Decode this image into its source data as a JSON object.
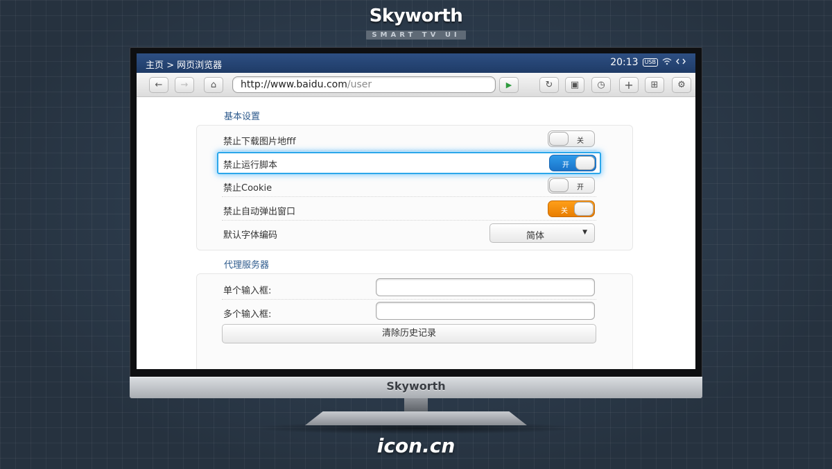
{
  "brand": {
    "name": "Skyworth",
    "subtitle": "SMART TV UI",
    "bezel_name": "Skyworth",
    "footer": "icon.cn"
  },
  "status_bar": {
    "breadcrumb": "主页 > 网页浏览器",
    "time": "20:13",
    "usb": "USB",
    "icons": [
      "wifi-icon",
      "network-transfer-icon"
    ]
  },
  "toolbar": {
    "url_host": "http://www.baidu.com",
    "url_path": "/user",
    "icons": {
      "back": "←",
      "forward": "→",
      "home": "⌂",
      "go": "▶",
      "refresh": "↻",
      "tabs": "▣",
      "history": "◷",
      "add": "+",
      "bookmarks": "⊞",
      "settings": "⚙"
    }
  },
  "sections": {
    "basic": {
      "heading": "基本设置",
      "rows": [
        {
          "label": "禁止下载图片地fff",
          "toggle": "关",
          "state": "off"
        },
        {
          "label": "禁止运行脚本",
          "toggle": "开",
          "state": "on"
        },
        {
          "label": "禁止Cookie",
          "toggle": "开",
          "state": "off"
        },
        {
          "label": "禁止自动弹出窗口",
          "toggle": "关",
          "state": "on"
        }
      ],
      "encoding_label": "默认字体编码",
      "encoding_value": "简体",
      "encoding_arrow": "▼"
    },
    "proxy": {
      "heading": "代理服务器",
      "single_label": "单个输入框:",
      "multi_label": "多个输入框:",
      "clear_button": "清除历史记录"
    }
  },
  "colors": {
    "status_bar": "#1f3b66",
    "focus_ring": "#2ba7ea",
    "toggle_on_blue": "#1a73c9",
    "toggle_on_orange": "#e97e00",
    "section_heading": "#2d5a8c",
    "go_arrow": "#2e9b3e"
  }
}
